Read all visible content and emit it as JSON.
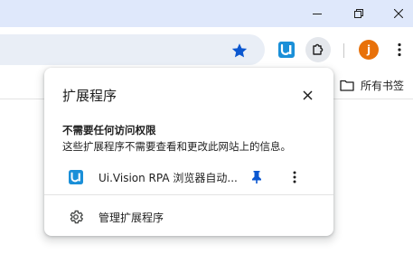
{
  "window_controls": {
    "minimize_icon": "minimize-icon",
    "restore_icon": "restore-icon",
    "close_icon": "close-icon"
  },
  "toolbar": {
    "bookmark_star_icon": "star-icon",
    "uivision_icon": "ui-vision-extension-icon",
    "extensions_icon": "puzzle-icon",
    "profile_initial": "j",
    "profile_color": "#e8710a",
    "menu_icon": "more-vert-icon",
    "accent_color": "#0b57d0"
  },
  "bookmarks_bar": {
    "all_bookmarks_label": "所有书签"
  },
  "extensions_popup": {
    "title": "扩展程序",
    "section_heading": "不需要任何访问权限",
    "section_description": "这些扩展程序不需要查看和更改此网站上的信息。",
    "extensions": [
      {
        "name": "Ui.Vision RPA 浏览器自动...",
        "pinned": true
      }
    ],
    "manage_label": "管理扩展程序"
  }
}
